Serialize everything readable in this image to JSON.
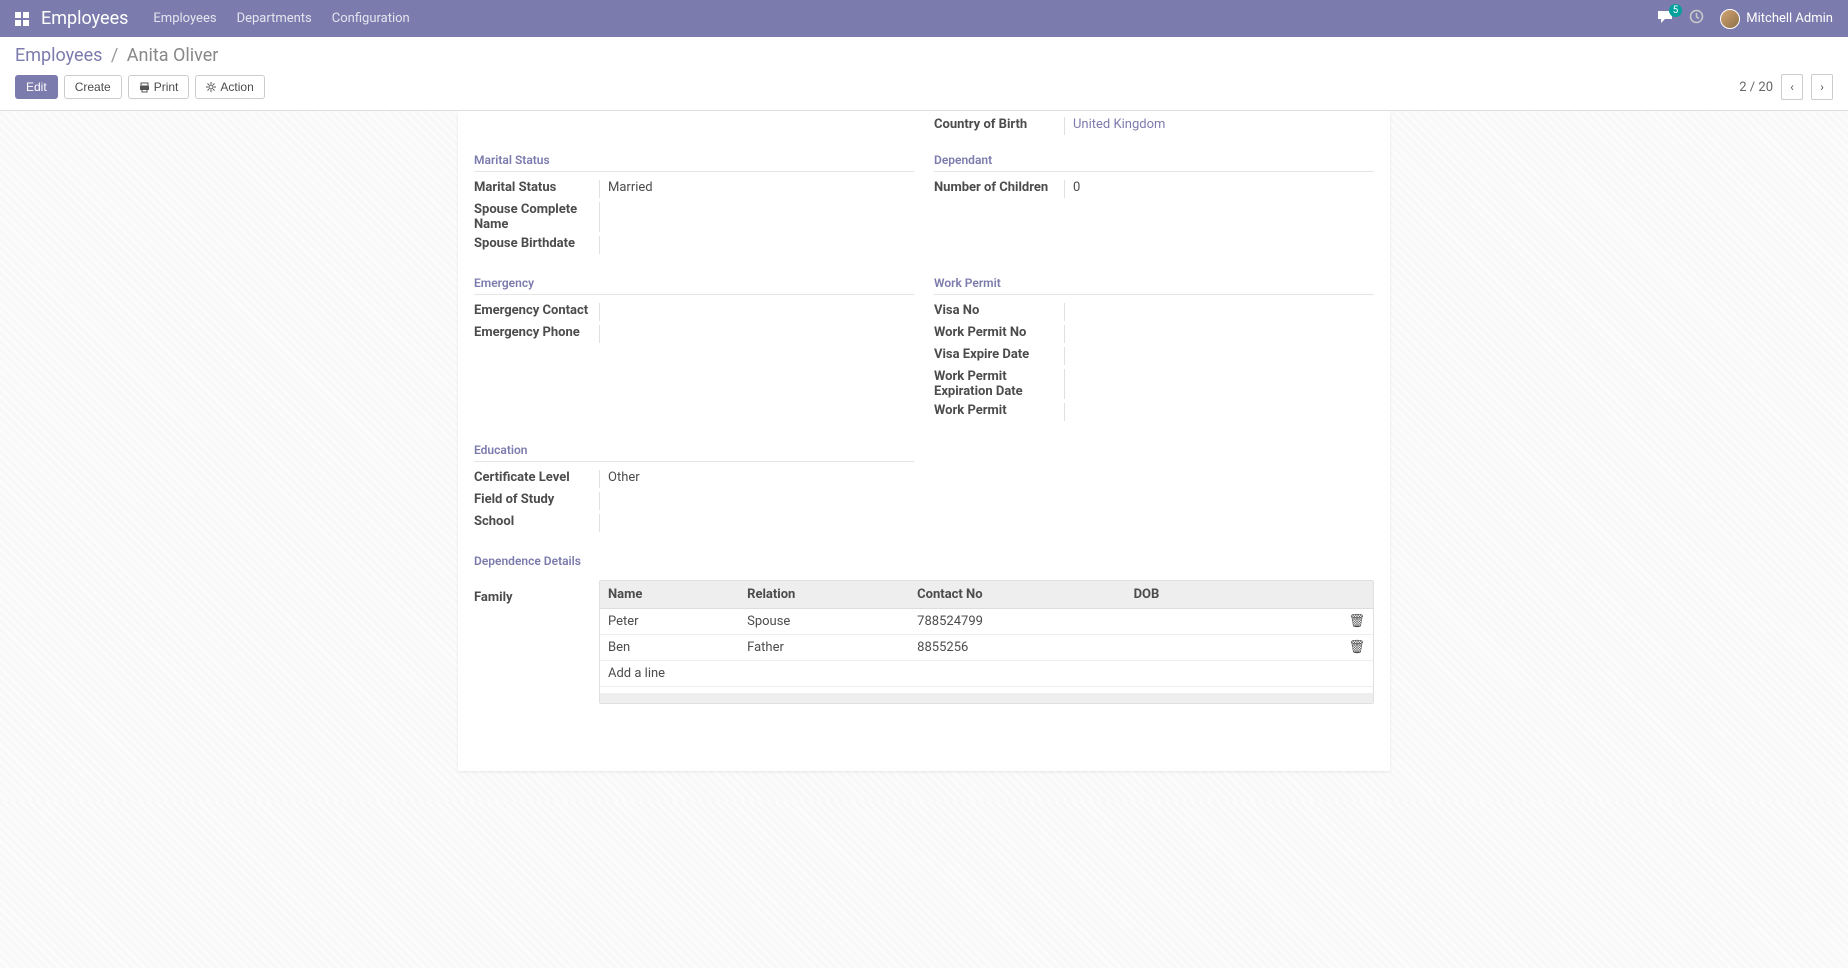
{
  "nav": {
    "brand": "Employees",
    "links": [
      "Employees",
      "Departments",
      "Configuration"
    ],
    "badge": "5",
    "user": "Mitchell Admin"
  },
  "breadcrumb": {
    "parent": "Employees",
    "current": "Anita Oliver"
  },
  "buttons": {
    "edit": "Edit",
    "create": "Create",
    "print": "Print",
    "action": "Action"
  },
  "pager": {
    "label": "2 / 20"
  },
  "sections": {
    "country_of_birth_label": "Country of Birth",
    "country_of_birth_value": "United Kingdom",
    "marital_status_title": "Marital Status",
    "marital_status_label": "Marital Status",
    "marital_status_value": "Married",
    "spouse_name_label": "Spouse Complete Name",
    "spouse_birthdate_label": "Spouse Birthdate",
    "dependant_title": "Dependant",
    "num_children_label": "Number of Children",
    "num_children_value": "0",
    "emergency_title": "Emergency",
    "emergency_contact_label": "Emergency Contact",
    "emergency_phone_label": "Emergency Phone",
    "work_permit_title": "Work Permit",
    "visa_no_label": "Visa No",
    "work_permit_no_label": "Work Permit No",
    "visa_expire_label": "Visa Expire Date",
    "work_permit_exp_label": "Work Permit Expiration Date",
    "work_permit_label": "Work Permit",
    "education_title": "Education",
    "cert_level_label": "Certificate Level",
    "cert_level_value": "Other",
    "field_study_label": "Field of Study",
    "school_label": "School",
    "dep_details_title": "Dependence Details",
    "family_label": "Family"
  },
  "family_table": {
    "headers": {
      "name": "Name",
      "relation": "Relation",
      "contact": "Contact No",
      "dob": "DOB"
    },
    "rows": [
      {
        "name": "Peter",
        "relation": "Spouse",
        "contact": "788524799",
        "dob": ""
      },
      {
        "name": "Ben",
        "relation": "Father",
        "contact": "8855256",
        "dob": ""
      }
    ],
    "add_line": "Add a line"
  }
}
